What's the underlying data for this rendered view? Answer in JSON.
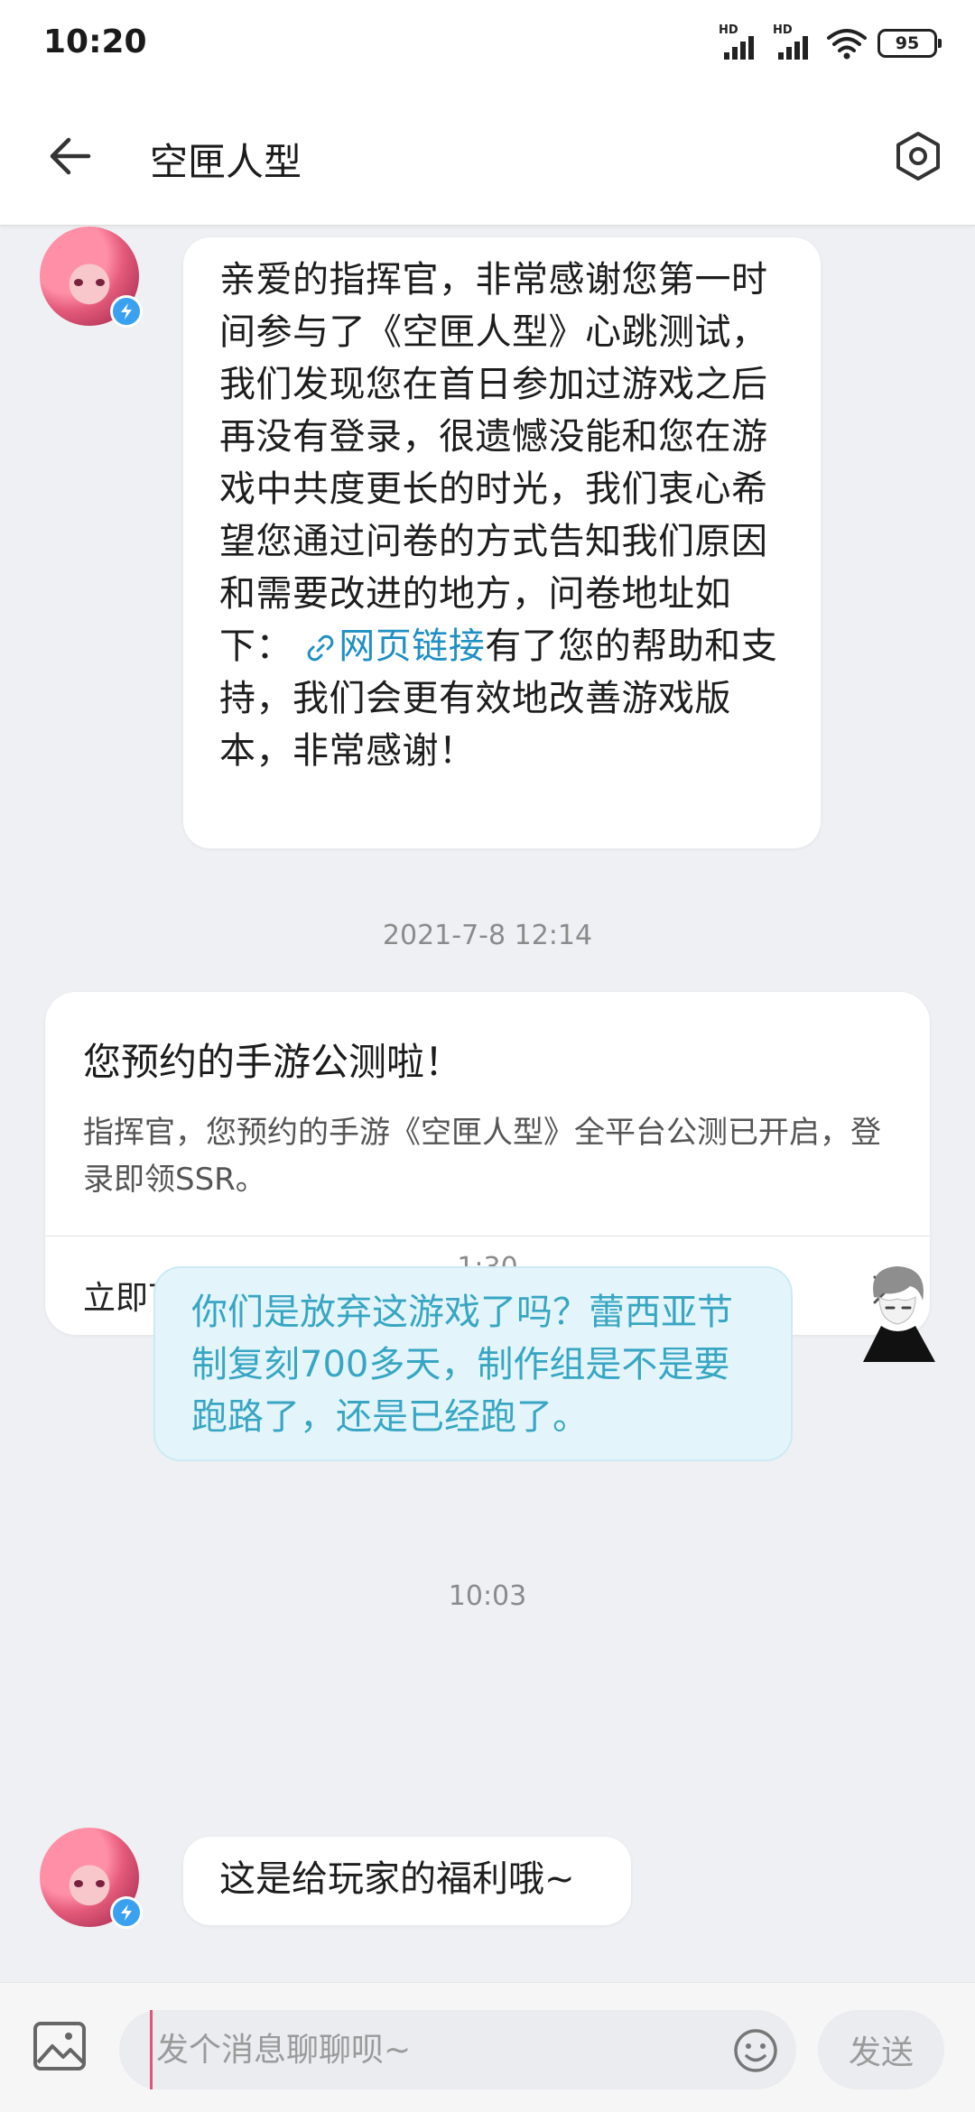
{
  "status_bar": {
    "time": "10:20",
    "signal_1_label": "HD",
    "signal_2_label": "HD",
    "battery": "95",
    "icons": [
      "signal-hd-icon",
      "signal-hd-icon",
      "wifi-icon",
      "battery-icon"
    ]
  },
  "header": {
    "title": "空匣人型",
    "back_icon": "arrow-left-icon",
    "settings_icon": "hexagon-gear-icon"
  },
  "messages": {
    "m1": {
      "sender": "bot",
      "text_before_link": "亲爱的指挥官，非常感谢您第一时间参与了《空匣人型》心跳测试，我们发现您在首日参加过游戏之后再没有登录，很遗憾没能和您在游戏中共度更长的时光，我们衷心希望您通过问卷的方式告知我们原因和需要改进的地方，问卷地址如下：",
      "link_label": "网页链接",
      "text_after_link": "有了您的帮助和支持，我们会更有效地改善游戏版本，非常感谢！"
    },
    "ts1": "2021-7-8 12:14",
    "card": {
      "title": "您预约的手游公测啦！",
      "body": "指挥官，您预约的手游《空匣人型》全平台公测已开启，登录即领SSR。",
      "action_label": "立即下载"
    },
    "ts2": "1:30",
    "m2": {
      "sender": "me",
      "text": "你们是放弃这游戏了吗？蕾西亚节制复刻700多天，制作组是不是要跑路了，还是已经跑了。"
    },
    "ts3": "10:03",
    "m3": {
      "sender": "bot",
      "text": "这是给玩家的福利哦~"
    }
  },
  "input_bar": {
    "placeholder": "发个消息聊聊呗~",
    "value": "",
    "send_label": "发送"
  },
  "colors": {
    "background": "#eef0f3",
    "link": "#1f8fc4",
    "my_bubble_bg": "#e3f5fb",
    "my_bubble_text": "#38a6c3",
    "verify_badge": "#3aa0f0"
  }
}
